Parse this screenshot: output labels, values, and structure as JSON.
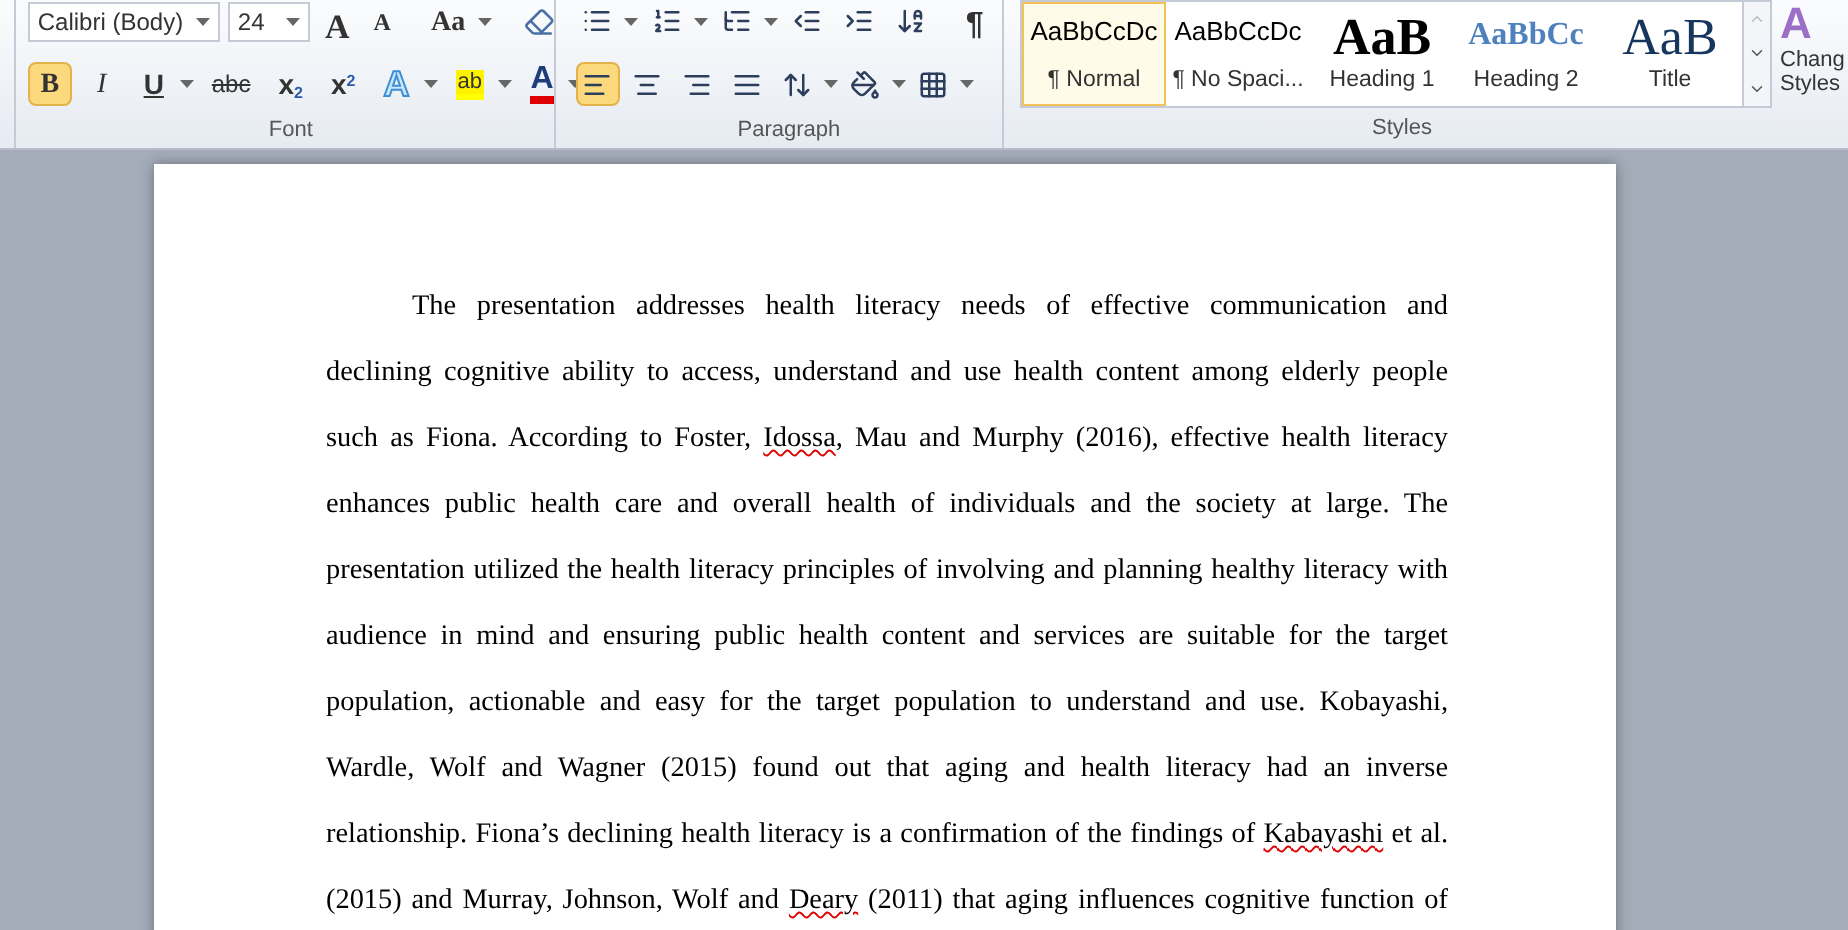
{
  "font_group": {
    "label": "Font",
    "font_name": "Calibri (Body)",
    "font_size": "24",
    "row1": [
      {
        "kind": "grow",
        "glyph": "A"
      },
      {
        "kind": "shrink",
        "glyph": "A"
      },
      {
        "kind": "case",
        "glyph": "Aa"
      },
      {
        "kind": "clear"
      }
    ],
    "row2": [
      {
        "kind": "bold",
        "glyph": "B",
        "selected": true
      },
      {
        "kind": "italic",
        "glyph": "I",
        "selected": false
      },
      {
        "kind": "underline",
        "glyph": "U",
        "selected": false
      },
      {
        "kind": "strike",
        "glyph": "abc",
        "selected": false
      },
      {
        "kind": "sub",
        "glyph": "x",
        "index": "2",
        "selected": false
      },
      {
        "kind": "sup",
        "glyph": "x",
        "index": "2",
        "selected": false
      },
      {
        "kind": "effects",
        "glyph": "A",
        "selected": false
      },
      {
        "kind": "highlight",
        "glyph": "ab",
        "selected": false
      },
      {
        "kind": "color",
        "glyph": "A",
        "selected": false
      }
    ]
  },
  "paragraph_group": {
    "label": "Paragraph",
    "row1": [
      {
        "kind": "bullets"
      },
      {
        "kind": "numbering"
      },
      {
        "kind": "multilevel"
      },
      {
        "kind": "outdent"
      },
      {
        "kind": "indent"
      },
      {
        "kind": "sort"
      },
      {
        "kind": "marks",
        "glyph": "¶"
      }
    ],
    "row2": [
      {
        "kind": "left",
        "selected": true
      },
      {
        "kind": "center",
        "selected": false
      },
      {
        "kind": "right",
        "selected": false
      },
      {
        "kind": "justify",
        "selected": false
      },
      {
        "kind": "spacing",
        "selected": false
      },
      {
        "kind": "shading",
        "selected": false
      },
      {
        "kind": "borders",
        "selected": false
      }
    ]
  },
  "styles_group": {
    "label": "Styles",
    "items": [
      {
        "preview": "AaBbCcDc",
        "label": "¶ Normal",
        "kind": "normal",
        "selected": true
      },
      {
        "preview": "AaBbCcDc",
        "label": "¶ No Spaci...",
        "kind": "normal",
        "selected": false
      },
      {
        "preview": "AaB",
        "label": "Heading 1",
        "kind": "heading1",
        "selected": false
      },
      {
        "preview": "AaBbCc",
        "label": "Heading 2",
        "kind": "heading2",
        "selected": false
      },
      {
        "preview": "AaB",
        "label": "Title",
        "kind": "title",
        "selected": false
      }
    ],
    "change_styles": {
      "glyph": "A",
      "label": [
        "Chang",
        "Styles"
      ]
    }
  },
  "document": {
    "lines": [
      {
        "indent": true,
        "segments": [
          {
            "text": "The presentation addresses health literacy needs of effective communication and"
          }
        ]
      },
      {
        "segments": [
          {
            "text": "declining cognitive ability to access, understand and use health content among elderly people"
          }
        ]
      },
      {
        "segments": [
          {
            "text": "such as Fiona. According to Foster, "
          },
          {
            "text": "Idossa",
            "spelling_error": true
          },
          {
            "text": ", Mau and Murphy (2016), effective health literacy"
          }
        ]
      },
      {
        "segments": [
          {
            "text": "enhances public health care and overall health of individuals and the society at large. The"
          }
        ]
      },
      {
        "segments": [
          {
            "text": "presentation utilized the health literacy principles of involving and planning healthy literacy with"
          }
        ]
      },
      {
        "segments": [
          {
            "text": "audience in mind and ensuring public health content and services are suitable for the target"
          }
        ]
      },
      {
        "segments": [
          {
            "text": "population, actionable and easy for the target population to understand and use. Kobayashi,"
          }
        ]
      },
      {
        "segments": [
          {
            "text": "Wardle, Wolf and Wagner (2015) found out that aging and health literacy had an inverse"
          }
        ]
      },
      {
        "segments": [
          {
            "text": "relationship. Fiona’s declining health literacy is a confirmation of the findings of "
          },
          {
            "text": "Kabayashi",
            "spelling_error": true
          },
          {
            "text": " et al."
          }
        ]
      },
      {
        "segments": [
          {
            "text": "(2015) and Murray, Johnson, Wolf and "
          },
          {
            "text": "Deary",
            "spelling_error": true
          },
          {
            "text": " (2011) that aging influences cognitive function of"
          }
        ]
      }
    ]
  }
}
